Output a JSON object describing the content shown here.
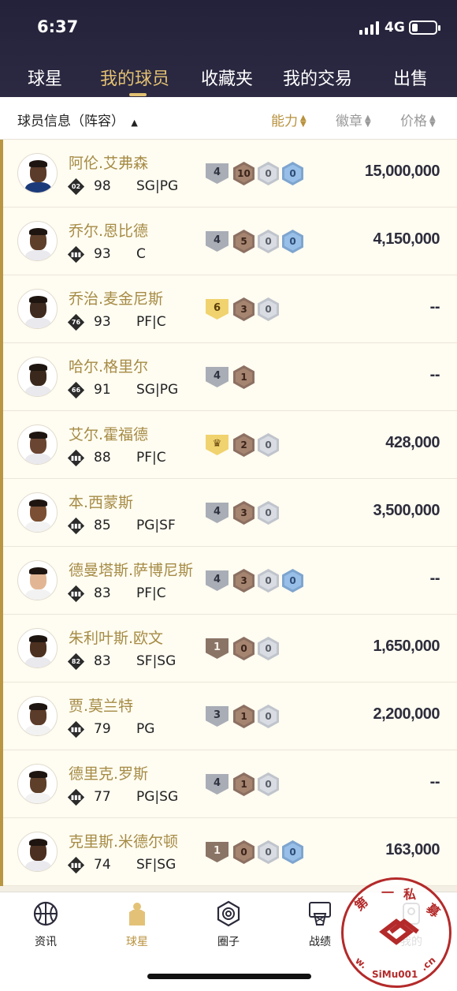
{
  "status": {
    "time": "6:37",
    "network": "4G"
  },
  "tabs": [
    {
      "label": "球星",
      "active": false
    },
    {
      "label": "我的球员",
      "active": true
    },
    {
      "label": "收藏夹",
      "active": false
    },
    {
      "label": "我的交易",
      "active": false
    },
    {
      "label": "出售",
      "active": false
    }
  ],
  "filter": {
    "left_label": "球员信息（阵容）",
    "sort_ability": "能力",
    "sort_badge": "徽章",
    "sort_price": "价格"
  },
  "players": [
    {
      "name": "阿伦.艾弗森",
      "rating": "98",
      "position": "SG|PG",
      "tag": "02",
      "price": "15,000,000",
      "level": "4",
      "badges": [
        "10",
        "0",
        "0"
      ],
      "skin": "#5b3b29",
      "jersey": "#1b3a7a",
      "crown": false
    },
    {
      "name": "乔尔.恩比德",
      "rating": "93",
      "position": "C",
      "tag": "bars",
      "price": "4,150,000",
      "level": "4",
      "badges": [
        "5",
        "0",
        "0"
      ],
      "skin": "#5e3f2a",
      "jersey": "#e9e9ee",
      "crown": false
    },
    {
      "name": "乔治.麦金尼斯",
      "rating": "93",
      "position": "PF|C",
      "tag": "76",
      "price": "--",
      "level": "6",
      "badges": [
        "3",
        "0"
      ],
      "skin": "#3e2a1e",
      "jersey": "#e9e9ee",
      "crown": false
    },
    {
      "name": "哈尔.格里尔",
      "rating": "91",
      "position": "SG|PG",
      "tag": "66",
      "price": "--",
      "level": "4",
      "badges": [
        "1"
      ],
      "skin": "#3a281c",
      "jersey": "#e9e9ee",
      "crown": false
    },
    {
      "name": "艾尔.霍福德",
      "rating": "88",
      "position": "PF|C",
      "tag": "bars",
      "price": "428,000",
      "level": "crown",
      "badges": [
        "2",
        "0"
      ],
      "skin": "#6a4632",
      "jersey": "#e9e9ee",
      "crown": true
    },
    {
      "name": "本.西蒙斯",
      "rating": "85",
      "position": "PG|SF",
      "tag": "bars",
      "price": "3,500,000",
      "level": "4",
      "badges": [
        "3",
        "0"
      ],
      "skin": "#7a4f33",
      "jersey": "#f2f2f2",
      "crown": false
    },
    {
      "name": "德曼塔斯.萨博尼斯",
      "rating": "83",
      "position": "PF|C",
      "tag": "bars",
      "price": "--",
      "level": "4",
      "badges": [
        "3",
        "0",
        "0"
      ],
      "skin": "#e2b694",
      "jersey": "#f2f2f2",
      "crown": false
    },
    {
      "name": "朱利叶斯.欧文",
      "rating": "83",
      "position": "SF|SG",
      "tag": "82",
      "price": "1,650,000",
      "level": "1",
      "badges": [
        "0",
        "0"
      ],
      "skin": "#4c3020",
      "jersey": "#e9e9ee",
      "crown": false
    },
    {
      "name": "贾.莫兰特",
      "rating": "79",
      "position": "PG",
      "tag": "bars",
      "price": "2,200,000",
      "level": "3",
      "badges": [
        "1",
        "0"
      ],
      "skin": "#5b3b29",
      "jersey": "#f2f2f2",
      "crown": false
    },
    {
      "name": "德里克.罗斯",
      "rating": "77",
      "position": "PG|SG",
      "tag": "bars",
      "price": "--",
      "level": "4",
      "badges": [
        "1",
        "0"
      ],
      "skin": "#5e3f2a",
      "jersey": "#f2f2f2",
      "crown": false
    },
    {
      "name": "克里斯.米德尔顿",
      "rating": "74",
      "position": "SF|SG",
      "tag": "bars",
      "price": "163,000",
      "level": "1",
      "badges": [
        "0",
        "0",
        "0"
      ],
      "skin": "#4b2f20",
      "jersey": "#e9e9ee",
      "crown": false
    }
  ],
  "nav": [
    {
      "label": "资讯",
      "icon": "basketball-icon",
      "active": false
    },
    {
      "label": "球星",
      "icon": "player-jersey-icon",
      "active": true
    },
    {
      "label": "圈子",
      "icon": "community-icon",
      "active": false
    },
    {
      "label": "战绩",
      "icon": "hoop-icon",
      "active": false
    },
    {
      "label": "我的",
      "icon": "profile-icon",
      "active": false
    }
  ],
  "watermark": {
    "text": "第 一 私 募",
    "url": "www.SiMu001.cn"
  },
  "colors": {
    "header_bg": "#2a273f",
    "tab_active": "#e2c172",
    "player_name": "#a58b45",
    "row_bg": "#fffcf1",
    "accent_bar": "#b99641",
    "sort_active": "#b8923e"
  }
}
